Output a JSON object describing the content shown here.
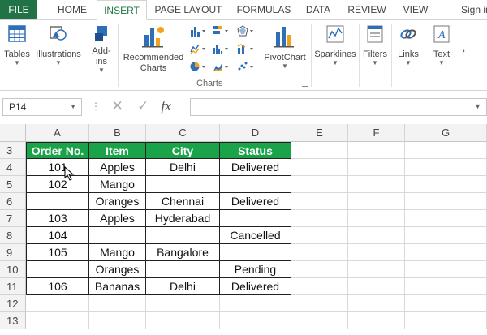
{
  "tabs": {
    "file": "FILE",
    "items": [
      {
        "label": "HOME",
        "active": false
      },
      {
        "label": "INSERT",
        "active": true
      },
      {
        "label": "PAGE LAYOUT",
        "active": false
      },
      {
        "label": "FORMULAS",
        "active": false
      },
      {
        "label": "DATA",
        "active": false
      },
      {
        "label": "REVIEW",
        "active": false
      },
      {
        "label": "VIEW",
        "active": false
      }
    ],
    "signin": "Sign in"
  },
  "ribbon": {
    "tables": "Tables",
    "illustrations": "Illustrations",
    "addins_1": "Add-",
    "addins_2": "ins",
    "recommended_1": "Recommended",
    "recommended_2": "Charts",
    "pivotchart": "PivotChart",
    "sparklines": "Sparklines",
    "filters": "Filters",
    "links": "Links",
    "text": "Text",
    "charts_group": "Charts",
    "more": "›"
  },
  "formula_bar": {
    "name_box": "P14",
    "fx": "fx",
    "value": ""
  },
  "grid": {
    "columns": [
      "A",
      "B",
      "C",
      "D",
      "E",
      "F",
      "G"
    ],
    "rows": [
      "3",
      "4",
      "5",
      "6",
      "7",
      "8",
      "9",
      "10",
      "11",
      "12",
      "13"
    ],
    "header": [
      "Order No.",
      "Item",
      "City",
      "Status"
    ],
    "data": [
      [
        "101",
        "Apples",
        "Delhi",
        "Delivered"
      ],
      [
        "102",
        "Mango",
        "",
        ""
      ],
      [
        "",
        "Oranges",
        "Chennai",
        "Delivered"
      ],
      [
        "103",
        "Apples",
        "Hyderabad",
        ""
      ],
      [
        "104",
        "",
        "",
        "Cancelled"
      ],
      [
        "105",
        "Mango",
        "Bangalore",
        ""
      ],
      [
        "",
        "Oranges",
        "",
        "Pending"
      ],
      [
        "106",
        "Bananas",
        "Delhi",
        "Delivered"
      ]
    ]
  },
  "colors": {
    "brand": "#217346",
    "table_header": "#1aa349"
  }
}
